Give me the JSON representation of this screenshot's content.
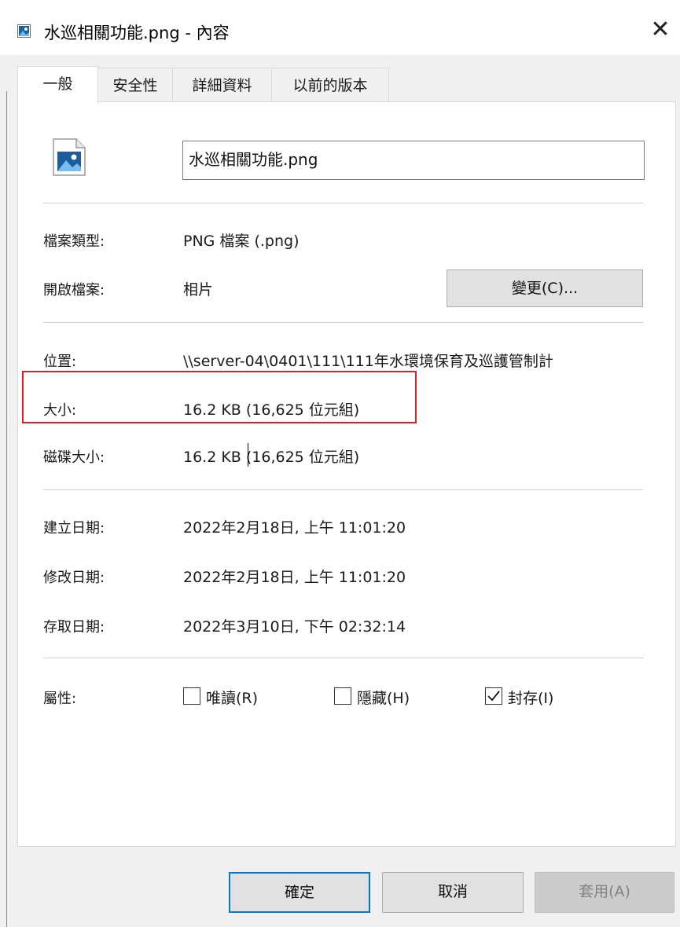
{
  "window": {
    "title": "水巡相關功能.png - 內容",
    "icon": "image-file-icon",
    "close_glyph": "✕"
  },
  "tabs": [
    {
      "label": "一般",
      "active": true
    },
    {
      "label": "安全性",
      "active": false
    },
    {
      "label": "詳細資料",
      "active": false
    },
    {
      "label": "以前的版本",
      "active": false
    }
  ],
  "general": {
    "file_icon": "image-file-icon",
    "file_name": "水巡相關功能.png",
    "file_type_label": "檔案類型:",
    "file_type_value": "PNG 檔案 (.png)",
    "opens_with_label": "開啟檔案:",
    "opens_with_value": "相片",
    "change_button": "變更(C)...",
    "location_label": "位置:",
    "location_value": "\\\\server-04\\0401\\111\\111年水環境保育及巡護管制計",
    "size_label": "大小:",
    "size_value": "16.2 KB (16,625 位元組)",
    "size_on_disk_label": "磁碟大小:",
    "size_on_disk_value": "16.2 KB (16,625 位元組)",
    "created_label": "建立日期:",
    "created_value": "2022年2月18日, 上午 11:01:20",
    "modified_label": "修改日期:",
    "modified_value": "2022年2月18日, 上午 11:01:20",
    "accessed_label": "存取日期:",
    "accessed_value": "2022年3月10日, 下午 02:32:14",
    "attributes_label": "屬性:",
    "attributes": [
      {
        "label": "唯讀(R)",
        "checked": false
      },
      {
        "label": "隱藏(H)",
        "checked": false
      },
      {
        "label": "封存(I)",
        "checked": true
      }
    ]
  },
  "buttons": {
    "ok": "確定",
    "cancel": "取消",
    "apply": "套用(A)"
  },
  "colors": {
    "highlight": "#e02020",
    "default_button_border": "#0078d7",
    "panel_bg": "#ffffff",
    "dialog_bg": "#f0f0f0"
  }
}
